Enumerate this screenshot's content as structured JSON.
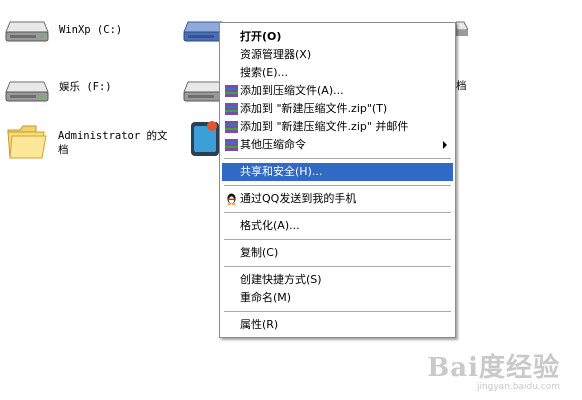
{
  "desktop": {
    "items": [
      {
        "label": "WinXp (C:)",
        "icon": "hard-drive-icon"
      },
      {
        "label": "娱乐 (F:)",
        "icon": "hard-drive-icon"
      },
      {
        "label_line1": "Administrator 的文",
        "label_line2": "档",
        "icon": "folder-icon"
      },
      {
        "label": "档",
        "icon": "hard-drive-icon"
      }
    ]
  },
  "context_menu": {
    "items": [
      {
        "label": "打开(O)",
        "bold": true
      },
      {
        "label": "资源管理器(X)"
      },
      {
        "label": "搜索(E)..."
      },
      {
        "label": "添加到压缩文件(A)...",
        "icon": "winrar-icon"
      },
      {
        "label": "添加到 \"新建压缩文件.zip\"(T)",
        "icon": "winrar-icon"
      },
      {
        "label": "添加到 \"新建压缩文件.zip\" 并邮件",
        "icon": "winrar-icon"
      },
      {
        "label": "其他压缩命令",
        "icon": "winrar-icon",
        "submenu": true
      },
      {
        "label": "共享和安全(H)...",
        "highlighted": true
      },
      {
        "label": "通过QQ发送到我的手机",
        "icon": "qq-penguin-icon"
      },
      {
        "label": "格式化(A)..."
      },
      {
        "label": "复制(C)"
      },
      {
        "label": "创建快捷方式(S)"
      },
      {
        "label": "重命名(M)"
      },
      {
        "label": "属性(R)"
      }
    ],
    "highlight_color": "#316ac5"
  },
  "watermark": {
    "brand": "Bai度经验",
    "url": "jingyan.baidu.com"
  }
}
